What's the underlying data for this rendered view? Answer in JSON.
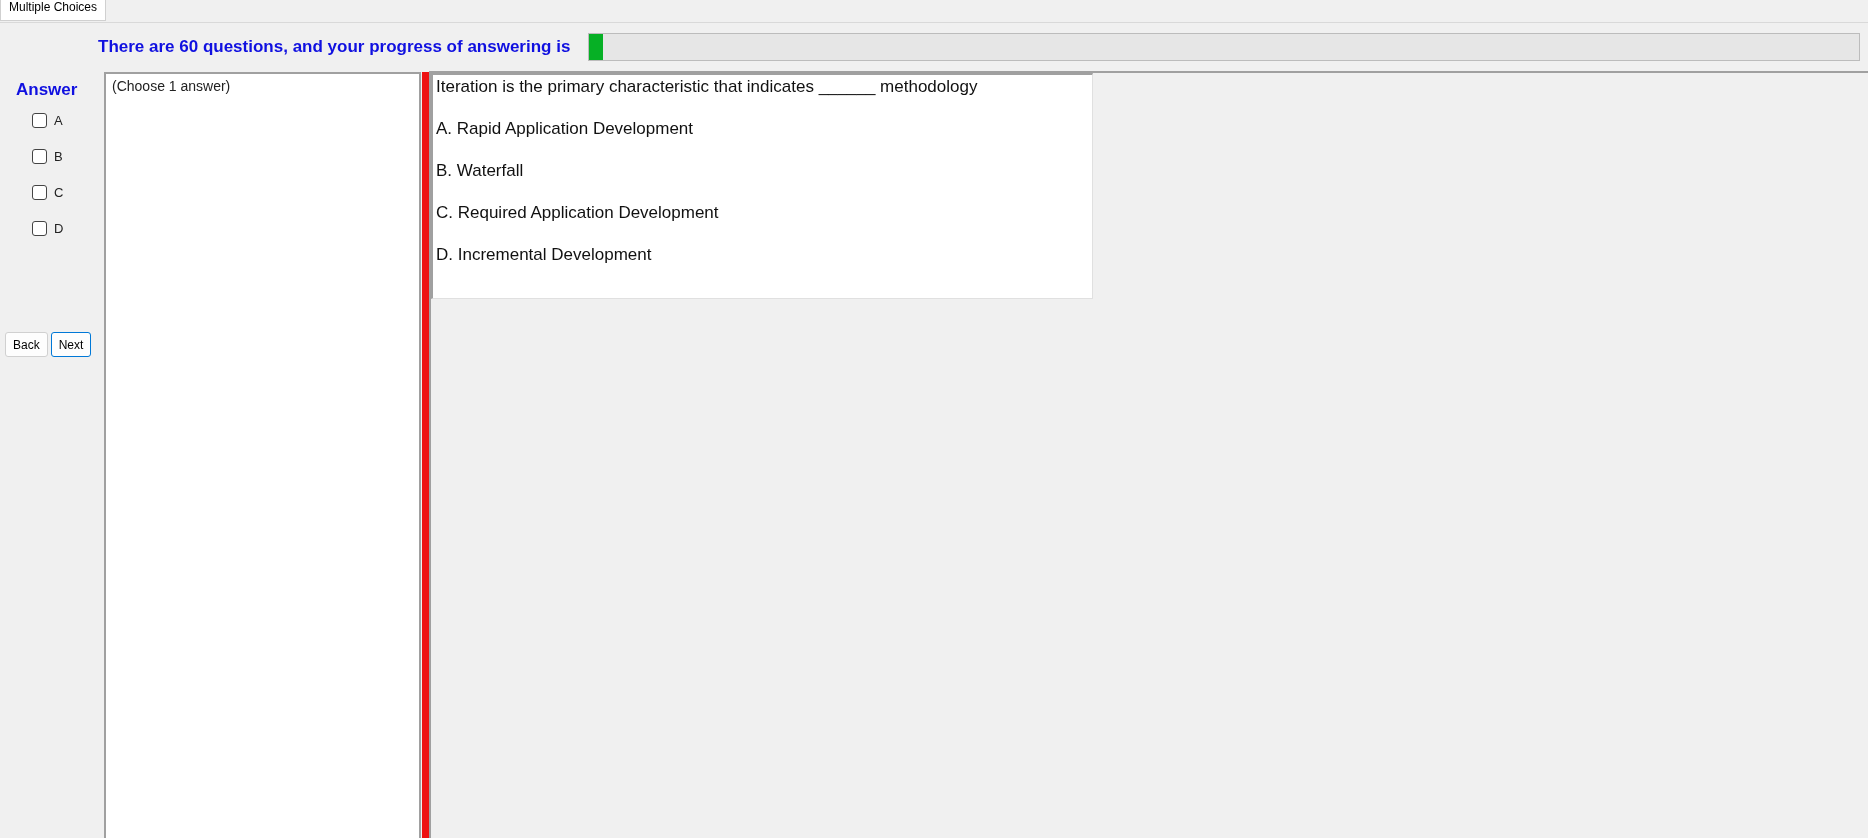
{
  "tab": {
    "label": "Multiple Choices",
    "selected": true
  },
  "progress": {
    "text": "There are 60 questions, and your progress of answering is",
    "level": 0.011
  },
  "answer": {
    "label": "Answer",
    "options": [
      {
        "label": "A",
        "checked": false
      },
      {
        "label": "B",
        "checked": false
      },
      {
        "label": "C",
        "checked": false
      },
      {
        "label": "D",
        "checked": false
      }
    ]
  },
  "buttons": [
    {
      "label": "Back",
      "focused": false
    },
    {
      "label": "Next",
      "focused": true
    }
  ],
  "hint": "(Choose 1 answer)",
  "question": {
    "text": "Iteration is the primary characteristic that indicates ______ methodology",
    "choices": [
      "A.  Rapid Application Development",
      "B.  Waterfall",
      "C.  Required Application Development",
      "D.  Incremental Development"
    ]
  }
}
